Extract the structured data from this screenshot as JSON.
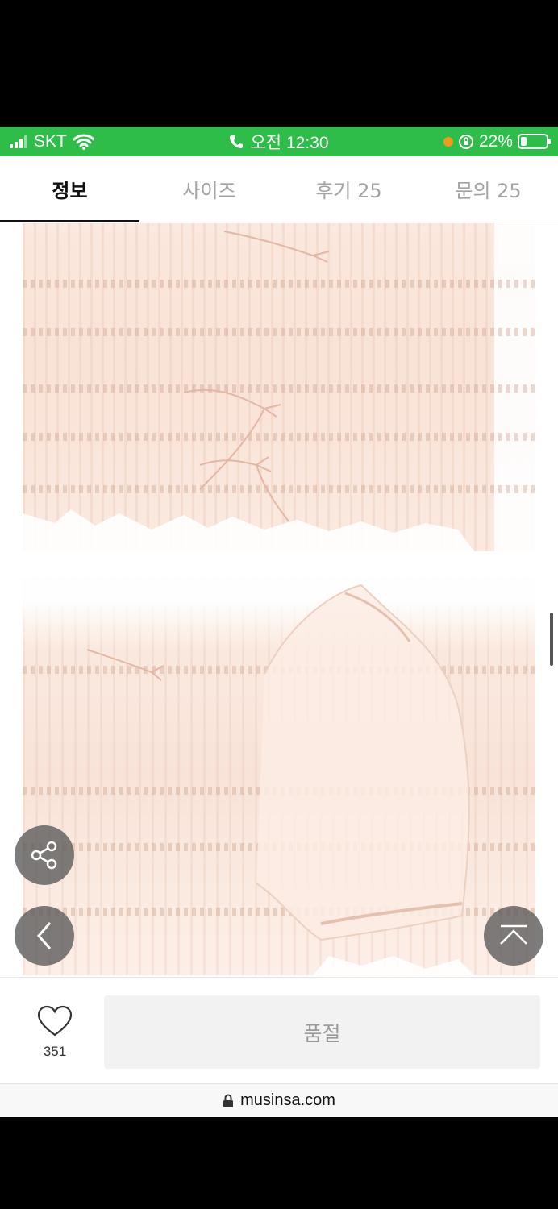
{
  "status_bar": {
    "carrier": "SKT",
    "time": "오전 12:30",
    "battery": "22%",
    "battery_level": 0.22
  },
  "tabs": [
    {
      "label": "정보",
      "active": true
    },
    {
      "label": "사이즈",
      "active": false
    },
    {
      "label": "후기 25",
      "active": false
    },
    {
      "label": "문의 25",
      "active": false
    }
  ],
  "icons": {
    "share": "share-icon",
    "back": "chevron-left-icon",
    "top": "scroll-to-top-icon",
    "like": "heart-icon",
    "lock": "lock-icon"
  },
  "like": {
    "count": "351"
  },
  "soldout_label": "품절",
  "url": "musinsa.com",
  "colors": {
    "status_green": "#2fbd4a",
    "fab_gray": "#5f5f5f",
    "disabled_text": "#9a9a9a"
  }
}
